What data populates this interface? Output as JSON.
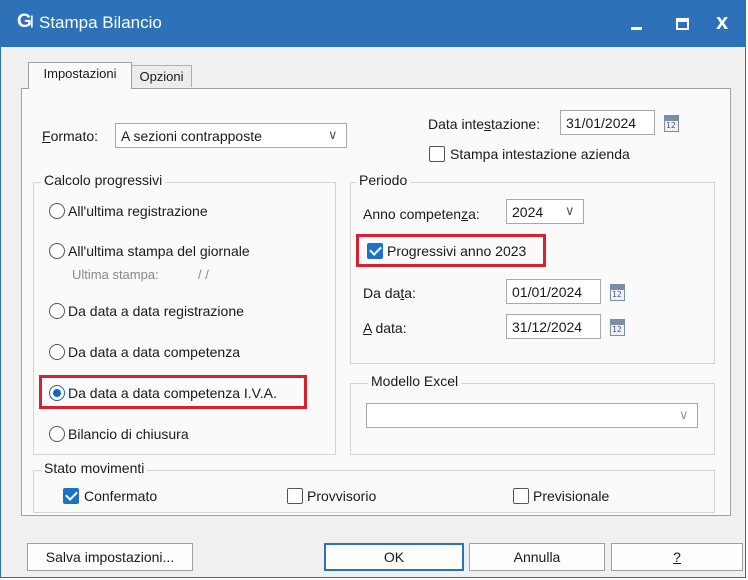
{
  "window": {
    "logo": "G",
    "title": "Stampa Bilancio",
    "close_glyph": "x"
  },
  "tabs": [
    {
      "label": "Impostazioni",
      "active": true
    },
    {
      "label": "Opzioni",
      "active": false
    }
  ],
  "formato": {
    "label_first": "F",
    "label_rest": "ormato:",
    "value": "A sezioni contrapposte"
  },
  "data_intestazione": {
    "label_a": "Data inte",
    "label_u": "s",
    "label_b": "tazione:",
    "value": "31/01/2024"
  },
  "stampa_intestazione": {
    "label": "Stampa intestazione azienda",
    "checked": false
  },
  "calcolo": {
    "legend": "Calcolo progressivi",
    "options": [
      {
        "label": "All'ultima registrazione",
        "selected": false
      },
      {
        "label": "All'ultima stampa del giornale",
        "selected": false
      },
      {
        "label": "Da data a data registrazione",
        "selected": false
      },
      {
        "label": "Da data a data competenza",
        "selected": false
      },
      {
        "label": "Da data a data competenza I.V.A.",
        "selected": true
      },
      {
        "label": "Bilancio di chiusura",
        "selected": false
      }
    ],
    "ultima_stampa_label": "Ultima stampa:",
    "ultima_stampa_value": "/  /"
  },
  "periodo": {
    "legend": "Periodo",
    "anno_label_a": "Anno competen",
    "anno_label_u": "z",
    "anno_label_b": "a:",
    "anno_value": "2024",
    "progressivi_label": "Progressivi anno 2023",
    "progressivi_checked": true,
    "da_label_a": "Da da",
    "da_label_u": "t",
    "da_label_b": "a:",
    "da_value": "01/01/2024",
    "a_label_u": "A",
    "a_label_b": " data:",
    "a_value": "31/12/2024"
  },
  "modello_excel": {
    "legend": "Modello Excel",
    "value": ""
  },
  "stato": {
    "legend": "Stato movimenti",
    "items": [
      {
        "label": "Confermato",
        "checked": true
      },
      {
        "label": "Provvisorio",
        "checked": false
      },
      {
        "label": "Previsionale",
        "checked": false
      }
    ]
  },
  "buttons": {
    "salva": "Salva impostazioni...",
    "ok": "OK",
    "annulla": "Annulla",
    "help": "?"
  },
  "calendar_icon_text": "12",
  "colors": {
    "titlebar": "#2d72b8",
    "highlight": "#d9202e",
    "accent": "#1a73c9"
  }
}
